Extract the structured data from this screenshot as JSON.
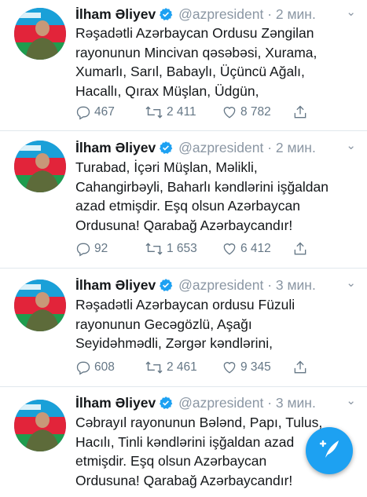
{
  "colors": {
    "accent": "#1da1f2",
    "text": "#14171a",
    "muted": "#8a96a3"
  },
  "tweets": [
    {
      "name": "İlham Əliyev",
      "handle": "@azpresident",
      "separator": "·",
      "time": "2 мин.",
      "lines": [
        "Rəşadətli Azərbaycan Ordusu Zəngilan",
        "rayonunun Mincivan qəsəbəsi, Xurama,",
        "Xumarlı, Sarıl, Babaylı, Üçüncü Ağalı,",
        "Hacallı, Qırax Müşlan, Üdgün,"
      ],
      "replies": "467",
      "retweets": "2 411",
      "likes": "8 782"
    },
    {
      "name": "İlham Əliyev",
      "handle": "@azpresident",
      "separator": "·",
      "time": "2 мин.",
      "lines": [
        "Turabad, İçəri Müşlan, Məlikli,",
        "Cahangirbəyli, Baharlı kəndlərini işğaldan",
        "azad etmişdir. Eşq olsun Azərbaycan",
        "Ordusuna! Qarabağ Azərbaycandır!"
      ],
      "replies": "92",
      "retweets": "1 653",
      "likes": "6 412"
    },
    {
      "name": "İlham Əliyev",
      "handle": "@azpresident",
      "separator": "·",
      "time": "3 мин.",
      "lines": [
        "Rəşadətli Azərbaycan ordusu Füzuli",
        "rayonunun Gecəgözlü, Aşağı",
        "Seyidəhmədli, Zərgər kəndlərini,"
      ],
      "replies": "608",
      "retweets": "2 461",
      "likes": "9 345"
    },
    {
      "name": "İlham Əliyev",
      "handle": "@azpresident",
      "separator": "·",
      "time": "3 мин.",
      "lines": [
        "Cəbrayıl rayonunun Bələnd, Papı, Tulus,",
        "Hacılı, Tinli kəndlərini işğaldan azad",
        "etmişdir. Eşq olsun Azərbaycan",
        "Ordusuna! Qarabağ Azərbaycandır!"
      ]
    }
  ],
  "icons": {
    "verified": "verified-badge-icon",
    "reply": "reply-icon",
    "retweet": "retweet-icon",
    "like": "heart-icon",
    "share": "share-icon",
    "menu": "chevron-down-icon",
    "compose": "compose-tweet-icon"
  }
}
